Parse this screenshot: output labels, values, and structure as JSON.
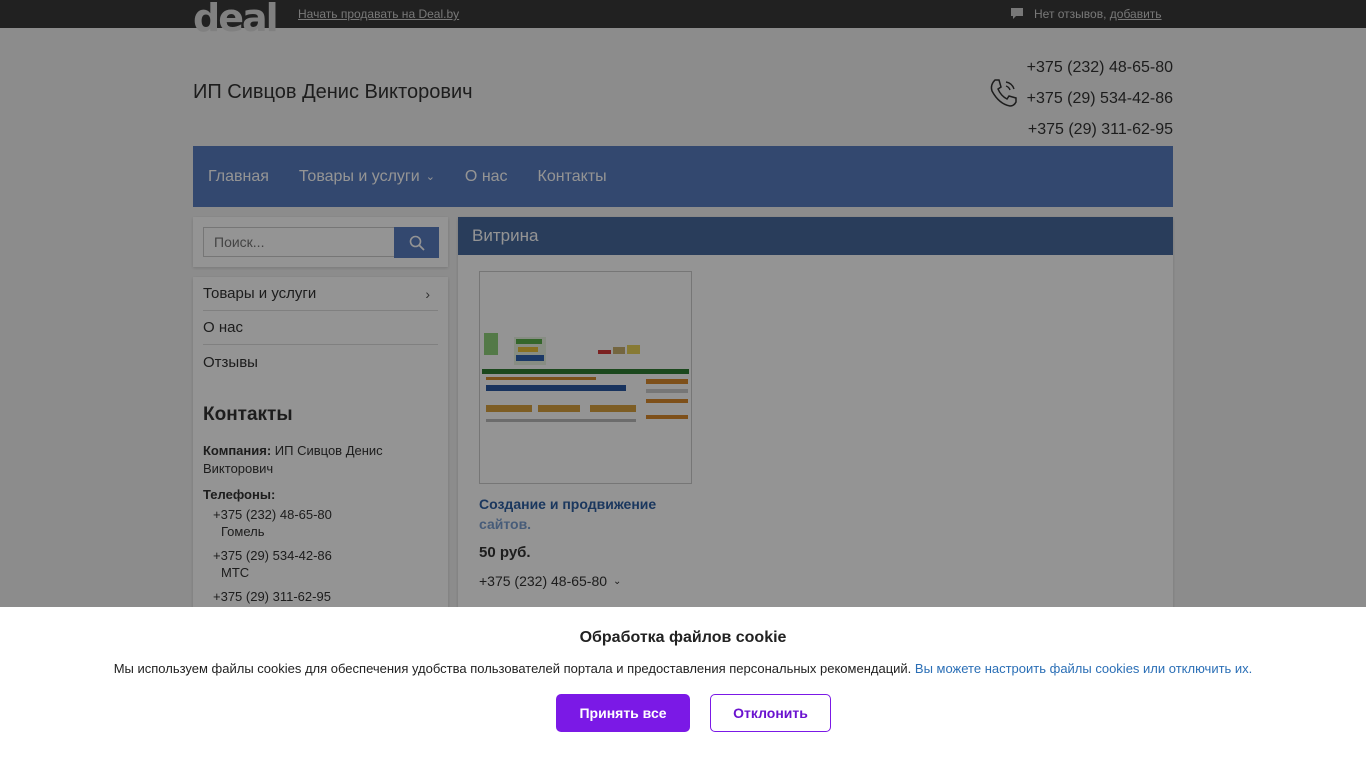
{
  "topbar": {
    "logo_text": "deal",
    "sell_link": "Начать продавать на Deal.by",
    "reviews_text": "Нет отзывов,",
    "reviews_add": "добавить"
  },
  "header": {
    "company_name": "ИП Сивцов Денис Викторович",
    "phones": [
      "+375 (232) 48-65-80",
      "+375 (29) 534-42-86",
      "+375 (29) 311-62-95"
    ]
  },
  "nav": {
    "items": [
      {
        "label": "Главная"
      },
      {
        "label": "Товары и услуги"
      },
      {
        "label": "О нас"
      },
      {
        "label": "Контакты"
      }
    ]
  },
  "sidebar": {
    "search_placeholder": "Поиск...",
    "menu": [
      {
        "label": "Товары и услуги"
      },
      {
        "label": "О нас"
      },
      {
        "label": "Отзывы"
      }
    ],
    "contacts_heading": "Контакты",
    "company_label": "Компания:",
    "company_value": "ИП Сивцов Денис Викторович",
    "phones_label": "Телефоны:",
    "phones": [
      {
        "number": "+375 (232) 48-65-80",
        "operator": "Гомель"
      },
      {
        "number": "+375 (29) 534-42-86",
        "operator": "МТС"
      },
      {
        "number": "+375 (29) 311-62-95",
        "operator": ""
      }
    ]
  },
  "showcase": {
    "title": "Витрина",
    "product": {
      "name_line1": "Создание и продвижение",
      "name_line2": "сайтов.",
      "price": "50 руб.",
      "phone": "+375 (232) 48-65-80"
    }
  },
  "cookie": {
    "title": "Обработка файлов cookie",
    "text": "Мы используем файлы cookies для обеспечения удобства пользователей портала и предоставления персональных рекомендаций.",
    "link": "Вы можете настроить файлы cookies или отключить их.",
    "accept": "Принять все",
    "decline": "Отклонить"
  },
  "colors": {
    "nav": "#587cbf",
    "accent_purple": "#7b19e6",
    "link": "#2b6fb6"
  }
}
